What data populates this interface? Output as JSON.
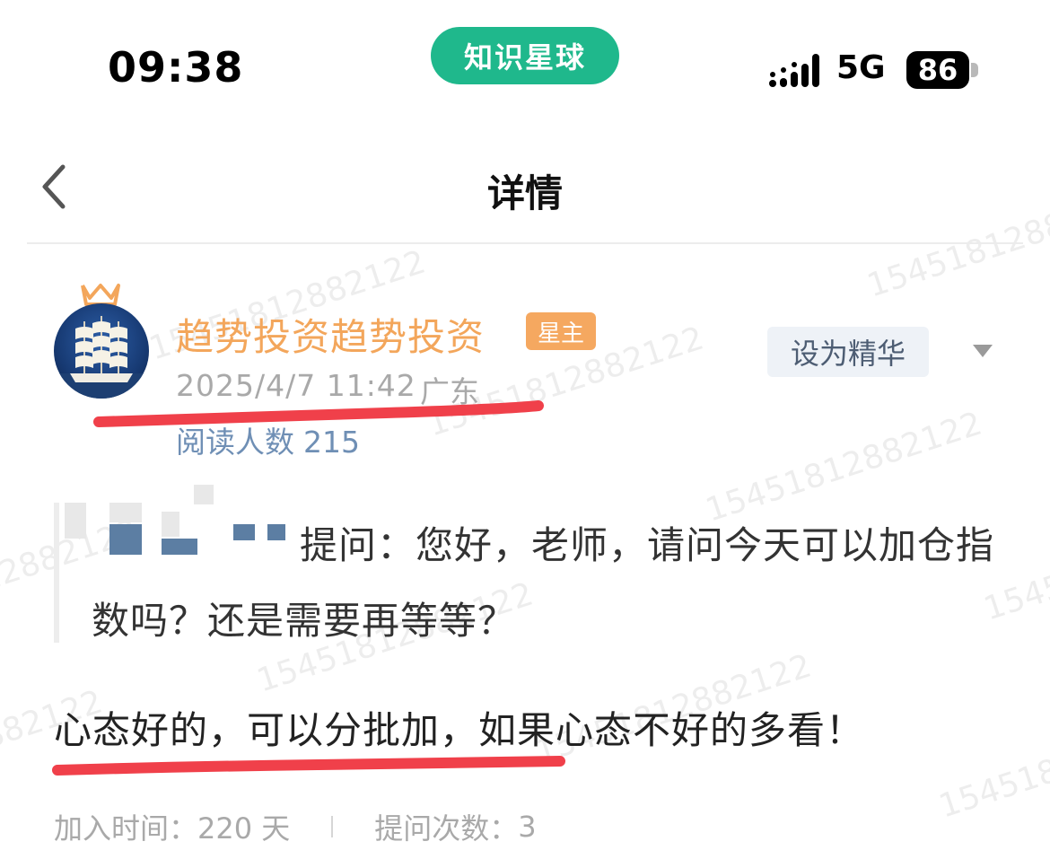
{
  "status_bar": {
    "time": "09:38",
    "app_name": "知识星球",
    "network": "5G",
    "battery": "86"
  },
  "nav": {
    "title": "详情"
  },
  "watermark": "15451812882122",
  "post": {
    "author": "趋势投资趋势投资",
    "role_badge": "星主",
    "datetime": "2025/4/7 11:42",
    "location": "广东",
    "read_label": "阅读人数",
    "read_count": "215",
    "essence_button": "设为精华",
    "question": "提问：您好，老师，请问今天可以加仓指数吗？还是需要再等等？",
    "answer": "心态好的，可以分批加，如果心态不好的多看！",
    "join_label": "加入时间：",
    "join_value": "220 天",
    "ask_label": "提问次数：",
    "ask_value": "3"
  },
  "colors": {
    "brand": "#1fb88c",
    "author_name": "#f3a65b",
    "annotation_red": "#f0404a",
    "read_count": "#6f8fb5"
  }
}
